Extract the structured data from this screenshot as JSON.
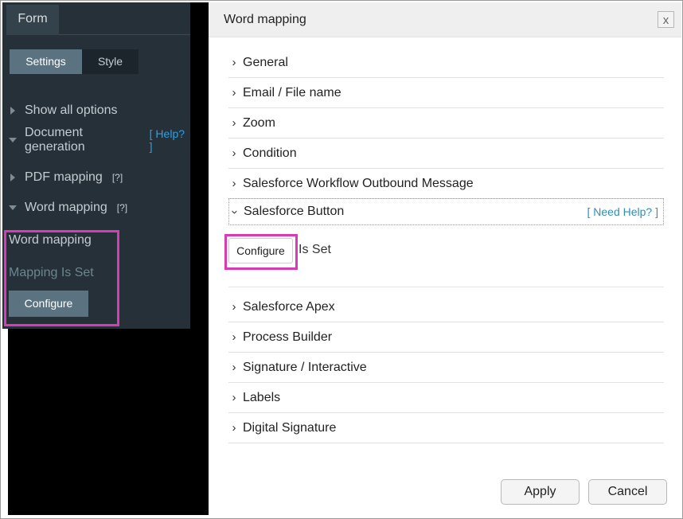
{
  "left_panel": {
    "tab_label": "Form",
    "segments": [
      "Settings",
      "Style"
    ],
    "tree": [
      {
        "label": "Show all options",
        "expanded": false
      },
      {
        "label": "Document generation",
        "expanded": true,
        "help": "[ Help? ]"
      },
      {
        "label": "PDF mapping",
        "expanded": false,
        "qmark": "[?]"
      },
      {
        "label": "Word mapping",
        "expanded": true,
        "qmark": "[?]"
      }
    ],
    "section_title": "Word mapping",
    "status": "Mapping Is Set",
    "configure_label": "Configure"
  },
  "dialog": {
    "title": "Word mapping",
    "close_glyph": "x",
    "sections": [
      {
        "label": "General",
        "expanded": false
      },
      {
        "label": "Email / File name",
        "expanded": false
      },
      {
        "label": "Zoom",
        "expanded": false
      },
      {
        "label": "Condition",
        "expanded": false
      },
      {
        "label": "Salesforce Workflow Outbound Message",
        "expanded": false
      },
      {
        "label": "Salesforce Button",
        "expanded": true,
        "help": "[ Need Help? ]"
      },
      {
        "label": "Salesforce Apex",
        "expanded": false
      },
      {
        "label": "Process Builder",
        "expanded": false
      },
      {
        "label": "Signature / Interactive",
        "expanded": false
      },
      {
        "label": "Labels",
        "expanded": false
      },
      {
        "label": "Digital Signature",
        "expanded": false
      }
    ],
    "open_section": {
      "configure_label": "Configure",
      "status_text": "Is Set"
    },
    "apply_label": "Apply",
    "cancel_label": "Cancel"
  },
  "colors": {
    "panel_bg": "#253038",
    "accent_button": "#5b7380",
    "highlight": "#d83bb5",
    "link": "#2f9fe2"
  }
}
